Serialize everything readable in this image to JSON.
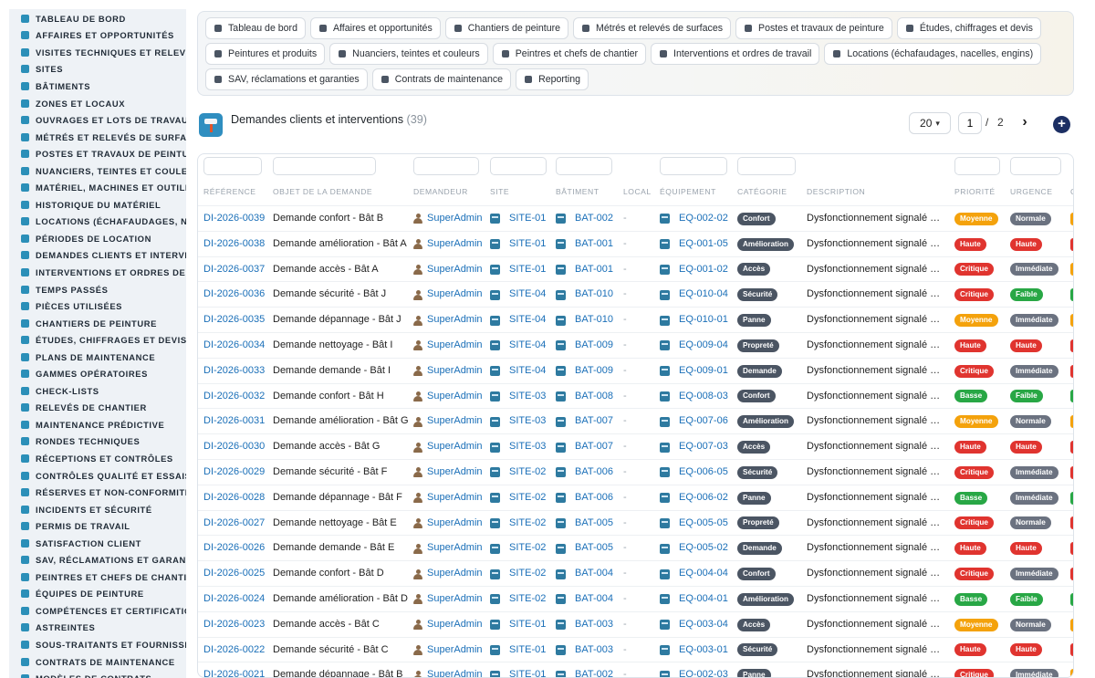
{
  "sidebar": {
    "items": [
      {
        "label": "TABLEAU DE BORD",
        "icon": "dashboard-icon"
      },
      {
        "label": "AFFAIRES ET OPPORTUNITÉS",
        "icon": "target-icon"
      },
      {
        "label": "VISITES TECHNIQUES ET RELEVÉS",
        "icon": "clipboard-icon"
      },
      {
        "label": "SITES",
        "icon": "map-pin-icon"
      },
      {
        "label": "BÂTIMENTS",
        "icon": "building-icon"
      },
      {
        "label": "ZONES ET LOCAUX",
        "icon": "grid-icon"
      },
      {
        "label": "OUVRAGES ET LOTS DE TRAVAUX",
        "icon": "layers-icon"
      },
      {
        "label": "MÉTRÉS ET RELEVÉS DE SURFACES",
        "icon": "ruler-icon"
      },
      {
        "label": "POSTES ET TRAVAUX DE PEINTURE",
        "icon": "roller-icon"
      },
      {
        "label": "NUANCIERS, TEINTES ET COULEURS",
        "icon": "palette-icon"
      },
      {
        "label": "MATÉRIEL, MACHINES ET OUTILLAGE",
        "icon": "tools-icon"
      },
      {
        "label": "HISTORIQUE DU MATÉRIEL",
        "icon": "history-icon"
      },
      {
        "label": "LOCATIONS (ÉCHAFAUDAGES, NACELLES, ENGINS)",
        "icon": "truck-icon"
      },
      {
        "label": "PÉRIODES DE LOCATION",
        "icon": "calendar-icon"
      },
      {
        "label": "DEMANDES CLIENTS ET INTERVENTIONS",
        "icon": "inbox-icon"
      },
      {
        "label": "INTERVENTIONS ET ORDRES DE TRAVAIL",
        "icon": "wrench-icon"
      },
      {
        "label": "TEMPS PASSÉS",
        "icon": "clock-icon"
      },
      {
        "label": "PIÈCES UTILISÉES",
        "icon": "box-icon"
      },
      {
        "label": "CHANTIERS DE PEINTURE",
        "icon": "brush-icon"
      },
      {
        "label": "ÉTUDES, CHIFFRAGES ET DEVIS",
        "icon": "calculator-icon"
      },
      {
        "label": "PLANS DE MAINTENANCE",
        "icon": "plan-icon"
      },
      {
        "label": "GAMMES OPÉRATOIRES",
        "icon": "list-icon"
      },
      {
        "label": "CHECK-LISTS",
        "icon": "checklist-icon"
      },
      {
        "label": "RELEVÉS DE CHANTIER",
        "icon": "notes-icon"
      },
      {
        "label": "MAINTENANCE PRÉDICTIVE",
        "icon": "chart-icon"
      },
      {
        "label": "RONDES TECHNIQUES",
        "icon": "route-icon"
      },
      {
        "label": "RÉCEPTIONS ET CONTRÔLES",
        "icon": "search-icon"
      },
      {
        "label": "CONTRÔLES QUALITÉ ET ESSAIS",
        "icon": "quality-icon"
      },
      {
        "label": "RÉSERVES ET NON-CONFORMITÉS",
        "icon": "flag-icon"
      },
      {
        "label": "INCIDENTS ET SÉCURITÉ",
        "icon": "alert-icon"
      },
      {
        "label": "PERMIS DE TRAVAIL",
        "icon": "permit-icon"
      },
      {
        "label": "SATISFACTION CLIENT",
        "icon": "smile-icon"
      },
      {
        "label": "SAV, RÉCLAMATIONS ET GARANTIES",
        "icon": "chat-icon"
      },
      {
        "label": "PEINTRES ET CHEFS DE CHANTIER",
        "icon": "helmet-icon"
      },
      {
        "label": "ÉQUIPES DE PEINTURE",
        "icon": "team-icon"
      },
      {
        "label": "COMPÉTENCES ET CERTIFICATIONS",
        "icon": "badge-icon"
      },
      {
        "label": "ASTREINTES",
        "icon": "phone-icon"
      },
      {
        "label": "SOUS-TRAITANTS ET FOURNISSEURS",
        "icon": "handshake-icon"
      },
      {
        "label": "CONTRATS DE MAINTENANCE",
        "icon": "contract-icon"
      },
      {
        "label": "MODÈLES DE CONTRATS",
        "icon": "file-icon"
      }
    ]
  },
  "quicknav": {
    "chips": [
      {
        "label": "Tableau de bord",
        "icon": "dashboard-icon"
      },
      {
        "label": "Affaires et opportunités",
        "icon": "target-icon"
      },
      {
        "label": "Chantiers de peinture",
        "icon": "brush-icon"
      },
      {
        "label": "Métrés et relevés de surfaces",
        "icon": "ruler-icon"
      },
      {
        "label": "Postes et travaux de peinture",
        "icon": "roller-icon"
      },
      {
        "label": "Études, chiffrages et devis",
        "icon": "calculator-icon"
      },
      {
        "label": "Peintures et produits",
        "icon": "paint-bucket-icon"
      },
      {
        "label": "Nuanciers, teintes et couleurs",
        "icon": "palette-icon"
      },
      {
        "label": "Peintres et chefs de chantier",
        "icon": "helmet-icon"
      },
      {
        "label": "Interventions et ordres de travail",
        "icon": "clipboard-icon"
      },
      {
        "label": "Locations (échafaudages, nacelles, engins)",
        "icon": "truck-icon"
      },
      {
        "label": "SAV, réclamations et garanties",
        "icon": "chat-icon"
      },
      {
        "label": "Contrats de maintenance",
        "icon": "contract-icon"
      },
      {
        "label": "Reporting",
        "icon": "pie-chart-icon"
      }
    ]
  },
  "page": {
    "title": "Demandes clients et interventions",
    "count": "(39)",
    "page_size": "20",
    "current_page": "1",
    "page_sep": "/",
    "total_pages": "2",
    "next_label": "›",
    "add_label": "+"
  },
  "table": {
    "headers": {
      "ref": "RÉFÉRENCE",
      "objet": "OBJET DE LA DEMANDE",
      "demandeur": "DEMANDEUR",
      "site": "SITE",
      "batiment": "BÂTIMENT",
      "local": "LOCAL",
      "equipement": "ÉQUIPEMENT",
      "categorie": "CATÉGORIE",
      "description": "DESCRIPTION",
      "priorite": "PRIORITÉ",
      "urgence": "URGENCE",
      "next": "C"
    },
    "colors": {
      "Moyenne": "#f4a20c",
      "Haute": "#e0342f",
      "Critique": "#e0342f",
      "Basse": "#28a745",
      "Normale": "#6b7280",
      "Immédiate": "#6b7280",
      "Faible": "#28a745"
    },
    "rows": [
      {
        "ref": "DI-2026-0039",
        "objet": "Demande confort - Bât B",
        "demandeur": "SuperAdmin",
        "site": "SITE-01",
        "batiment": "BAT-002",
        "local": "-",
        "equipement": "EQ-002-02",
        "categorie": "Confort",
        "description": "Dysfonctionnement signalé par le client",
        "priorite": "Moyenne",
        "urgence": "Normale",
        "last_color": "#f4a20c"
      },
      {
        "ref": "DI-2026-0038",
        "objet": "Demande amélioration - Bât A",
        "demandeur": "SuperAdmin",
        "site": "SITE-01",
        "batiment": "BAT-001",
        "local": "-",
        "equipement": "EQ-001-05",
        "categorie": "Amélioration",
        "description": "Dysfonctionnement signalé par le client",
        "priorite": "Haute",
        "urgence": "Haute",
        "last_color": "#e0342f"
      },
      {
        "ref": "DI-2026-0037",
        "objet": "Demande accès - Bât A",
        "demandeur": "SuperAdmin",
        "site": "SITE-01",
        "batiment": "BAT-001",
        "local": "-",
        "equipement": "EQ-001-02",
        "categorie": "Accès",
        "description": "Dysfonctionnement signalé par le client",
        "priorite": "Critique",
        "urgence": "Immédiate",
        "last_color": "#f4a20c"
      },
      {
        "ref": "DI-2026-0036",
        "objet": "Demande sécurité - Bât J",
        "demandeur": "SuperAdmin",
        "site": "SITE-04",
        "batiment": "BAT-010",
        "local": "-",
        "equipement": "EQ-010-04",
        "categorie": "Sécurité",
        "description": "Dysfonctionnement signalé par le client",
        "priorite": "Critique",
        "urgence": "Faible",
        "last_color": "#28a745"
      },
      {
        "ref": "DI-2026-0035",
        "objet": "Demande dépannage - Bât J",
        "demandeur": "SuperAdmin",
        "site": "SITE-04",
        "batiment": "BAT-010",
        "local": "-",
        "equipement": "EQ-010-01",
        "categorie": "Panne",
        "description": "Dysfonctionnement signalé par le client",
        "priorite": "Moyenne",
        "urgence": "Immédiate",
        "last_color": "#f4a20c"
      },
      {
        "ref": "DI-2026-0034",
        "objet": "Demande nettoyage - Bât I",
        "demandeur": "SuperAdmin",
        "site": "SITE-04",
        "batiment": "BAT-009",
        "local": "-",
        "equipement": "EQ-009-04",
        "categorie": "Propreté",
        "description": "Dysfonctionnement signalé par le client",
        "priorite": "Haute",
        "urgence": "Haute",
        "last_color": "#e0342f"
      },
      {
        "ref": "DI-2026-0033",
        "objet": "Demande demande - Bât I",
        "demandeur": "SuperAdmin",
        "site": "SITE-04",
        "batiment": "BAT-009",
        "local": "-",
        "equipement": "EQ-009-01",
        "categorie": "Demande",
        "description": "Dysfonctionnement signalé par le client",
        "priorite": "Critique",
        "urgence": "Immédiate",
        "last_color": "#e0342f"
      },
      {
        "ref": "DI-2026-0032",
        "objet": "Demande confort - Bât H",
        "demandeur": "SuperAdmin",
        "site": "SITE-03",
        "batiment": "BAT-008",
        "local": "-",
        "equipement": "EQ-008-03",
        "categorie": "Confort",
        "description": "Dysfonctionnement signalé par le client",
        "priorite": "Basse",
        "urgence": "Faible",
        "last_color": "#28a745"
      },
      {
        "ref": "DI-2026-0031",
        "objet": "Demande amélioration - Bât G",
        "demandeur": "SuperAdmin",
        "site": "SITE-03",
        "batiment": "BAT-007",
        "local": "-",
        "equipement": "EQ-007-06",
        "categorie": "Amélioration",
        "description": "Dysfonctionnement signalé par le client",
        "priorite": "Moyenne",
        "urgence": "Normale",
        "last_color": "#f4a20c"
      },
      {
        "ref": "DI-2026-0030",
        "objet": "Demande accès - Bât G",
        "demandeur": "SuperAdmin",
        "site": "SITE-03",
        "batiment": "BAT-007",
        "local": "-",
        "equipement": "EQ-007-03",
        "categorie": "Accès",
        "description": "Dysfonctionnement signalé par le client",
        "priorite": "Haute",
        "urgence": "Haute",
        "last_color": "#e0342f"
      },
      {
        "ref": "DI-2026-0029",
        "objet": "Demande sécurité - Bât F",
        "demandeur": "SuperAdmin",
        "site": "SITE-02",
        "batiment": "BAT-006",
        "local": "-",
        "equipement": "EQ-006-05",
        "categorie": "Sécurité",
        "description": "Dysfonctionnement signalé par le client",
        "priorite": "Critique",
        "urgence": "Immédiate",
        "last_color": "#e0342f"
      },
      {
        "ref": "DI-2026-0028",
        "objet": "Demande dépannage - Bât F",
        "demandeur": "SuperAdmin",
        "site": "SITE-02",
        "batiment": "BAT-006",
        "local": "-",
        "equipement": "EQ-006-02",
        "categorie": "Panne",
        "description": "Dysfonctionnement signalé par le client",
        "priorite": "Basse",
        "urgence": "Immédiate",
        "last_color": "#28a745"
      },
      {
        "ref": "DI-2026-0027",
        "objet": "Demande nettoyage - Bât E",
        "demandeur": "SuperAdmin",
        "site": "SITE-02",
        "batiment": "BAT-005",
        "local": "-",
        "equipement": "EQ-005-05",
        "categorie": "Propreté",
        "description": "Dysfonctionnement signalé par le client",
        "priorite": "Critique",
        "urgence": "Normale",
        "last_color": "#e0342f"
      },
      {
        "ref": "DI-2026-0026",
        "objet": "Demande demande - Bât E",
        "demandeur": "SuperAdmin",
        "site": "SITE-02",
        "batiment": "BAT-005",
        "local": "-",
        "equipement": "EQ-005-02",
        "categorie": "Demande",
        "description": "Dysfonctionnement signalé par le client",
        "priorite": "Haute",
        "urgence": "Haute",
        "last_color": "#e0342f"
      },
      {
        "ref": "DI-2026-0025",
        "objet": "Demande confort - Bât D",
        "demandeur": "SuperAdmin",
        "site": "SITE-02",
        "batiment": "BAT-004",
        "local": "-",
        "equipement": "EQ-004-04",
        "categorie": "Confort",
        "description": "Dysfonctionnement signalé par le client",
        "priorite": "Critique",
        "urgence": "Immédiate",
        "last_color": "#e0342f"
      },
      {
        "ref": "DI-2026-0024",
        "objet": "Demande amélioration - Bât D",
        "demandeur": "SuperAdmin",
        "site": "SITE-02",
        "batiment": "BAT-004",
        "local": "-",
        "equipement": "EQ-004-01",
        "categorie": "Amélioration",
        "description": "Dysfonctionnement signalé par le client",
        "priorite": "Basse",
        "urgence": "Faible",
        "last_color": "#28a745"
      },
      {
        "ref": "DI-2026-0023",
        "objet": "Demande accès - Bât C",
        "demandeur": "SuperAdmin",
        "site": "SITE-01",
        "batiment": "BAT-003",
        "local": "-",
        "equipement": "EQ-003-04",
        "categorie": "Accès",
        "description": "Dysfonctionnement signalé par le client",
        "priorite": "Moyenne",
        "urgence": "Normale",
        "last_color": "#f4a20c"
      },
      {
        "ref": "DI-2026-0022",
        "objet": "Demande sécurité - Bât C",
        "demandeur": "SuperAdmin",
        "site": "SITE-01",
        "batiment": "BAT-003",
        "local": "-",
        "equipement": "EQ-003-01",
        "categorie": "Sécurité",
        "description": "Dysfonctionnement signalé par le client",
        "priorite": "Haute",
        "urgence": "Haute",
        "last_color": "#e0342f"
      },
      {
        "ref": "DI-2026-0021",
        "objet": "Demande dépannage - Bât B",
        "demandeur": "SuperAdmin",
        "site": "SITE-01",
        "batiment": "BAT-002",
        "local": "-",
        "equipement": "EQ-002-03",
        "categorie": "Panne",
        "description": "Dysfonctionnement signalé par le client",
        "priorite": "Critique",
        "urgence": "Immédiate",
        "last_color": "#f4a20c"
      }
    ]
  }
}
